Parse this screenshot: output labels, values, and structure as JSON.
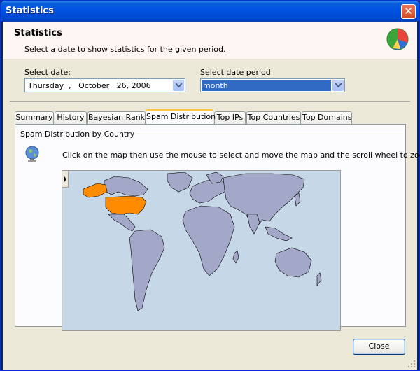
{
  "window": {
    "title": "Statistics"
  },
  "header": {
    "title": "Statistics",
    "subtitle": "Select a date to show statistics for the given period."
  },
  "date_picker": {
    "label": "Select date:",
    "value": "Thursday  ,   October   26, 2006"
  },
  "period": {
    "label": "Select date period",
    "value": "month"
  },
  "tabs": [
    {
      "label": "Summary"
    },
    {
      "label": "History"
    },
    {
      "label": "Bayesian Rank"
    },
    {
      "label": "Spam Distribution"
    },
    {
      "label": "Top IPs"
    },
    {
      "label": "Top Countries"
    },
    {
      "label": "Top Domains"
    }
  ],
  "active_tab": "Spam Distribution",
  "panel": {
    "group_label": "Spam Distribution by Country",
    "hint": "Click on the map then use the mouse to select and move the map and the scroll wheel to zoom.",
    "highlighted_countries_color": "#ff8c00",
    "land_color": "#a4a8c8",
    "ocean_color": "#c6d7e8"
  },
  "buttons": {
    "close": "Close"
  },
  "icons": {
    "header": "pie-chart-icon",
    "panel": "globe-icon",
    "window_close": "close-icon"
  }
}
